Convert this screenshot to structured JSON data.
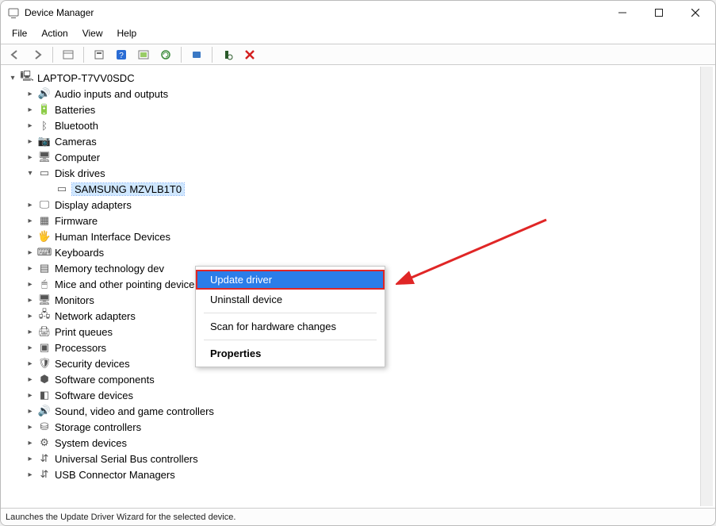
{
  "titlebar": {
    "title": "Device Manager"
  },
  "menu": [
    "File",
    "Action",
    "View",
    "Help"
  ],
  "toolbar_icons": [
    "back-icon",
    "forward-icon",
    "sep",
    "show-hidden-icon",
    "sep",
    "properties-icon",
    "help-icon",
    "sep",
    "update-driver-icon",
    "uninstall-icon",
    "sep",
    "disable-icon",
    "sep",
    "scan-hardware-icon",
    "delete-x-icon"
  ],
  "tree": {
    "root": "LAPTOP-T7VV0SDC",
    "root_expanded": true,
    "items": [
      {
        "label": "Audio inputs and outputs",
        "icon": "speaker-icon",
        "exp": "right"
      },
      {
        "label": "Batteries",
        "icon": "battery-icon",
        "exp": "right"
      },
      {
        "label": "Bluetooth",
        "icon": "bluetooth-icon",
        "exp": "right"
      },
      {
        "label": "Cameras",
        "icon": "camera-icon",
        "exp": "right"
      },
      {
        "label": "Computer",
        "icon": "monitor-icon",
        "exp": "right"
      },
      {
        "label": "Disk drives",
        "icon": "disk-icon",
        "exp": "down",
        "children": [
          {
            "label": "SAMSUNG MZVLB1T0",
            "icon": "disk-icon",
            "selected": true
          }
        ]
      },
      {
        "label": "Display adapters",
        "icon": "display-icon",
        "exp": "right"
      },
      {
        "label": "Firmware",
        "icon": "chip-icon",
        "exp": "right"
      },
      {
        "label": "Human Interface Devices",
        "icon": "hid-icon",
        "exp": "right"
      },
      {
        "label": "Keyboards",
        "icon": "keyboard-icon",
        "exp": "right"
      },
      {
        "label": "Memory technology dev",
        "icon": "memory-icon",
        "exp": "right"
      },
      {
        "label": "Mice and other pointing devices",
        "icon": "mouse-icon",
        "exp": "right"
      },
      {
        "label": "Monitors",
        "icon": "monitor-icon",
        "exp": "right"
      },
      {
        "label": "Network adapters",
        "icon": "network-icon",
        "exp": "right"
      },
      {
        "label": "Print queues",
        "icon": "printer-icon",
        "exp": "right"
      },
      {
        "label": "Processors",
        "icon": "cpu-icon",
        "exp": "right"
      },
      {
        "label": "Security devices",
        "icon": "shield-icon",
        "exp": "right"
      },
      {
        "label": "Software components",
        "icon": "component-icon",
        "exp": "right"
      },
      {
        "label": "Software devices",
        "icon": "software-icon",
        "exp": "right"
      },
      {
        "label": "Sound, video and game controllers",
        "icon": "speaker-icon",
        "exp": "right"
      },
      {
        "label": "Storage controllers",
        "icon": "storage-icon",
        "exp": "right"
      },
      {
        "label": "System devices",
        "icon": "system-icon",
        "exp": "right"
      },
      {
        "label": "Universal Serial Bus controllers",
        "icon": "usb-icon",
        "exp": "right"
      },
      {
        "label": "USB Connector Managers",
        "icon": "usb-icon",
        "exp": "right"
      }
    ]
  },
  "context_menu": {
    "items": [
      {
        "label": "Update driver",
        "selected": true,
        "highlight": true
      },
      {
        "label": "Uninstall device"
      },
      {
        "sep": true
      },
      {
        "label": "Scan for hardware changes"
      },
      {
        "sep": true
      },
      {
        "label": "Properties",
        "bold": true
      }
    ]
  },
  "status": "Launches the Update Driver Wizard for the selected device.",
  "annotation": {
    "arrow_color": "#e02626"
  }
}
